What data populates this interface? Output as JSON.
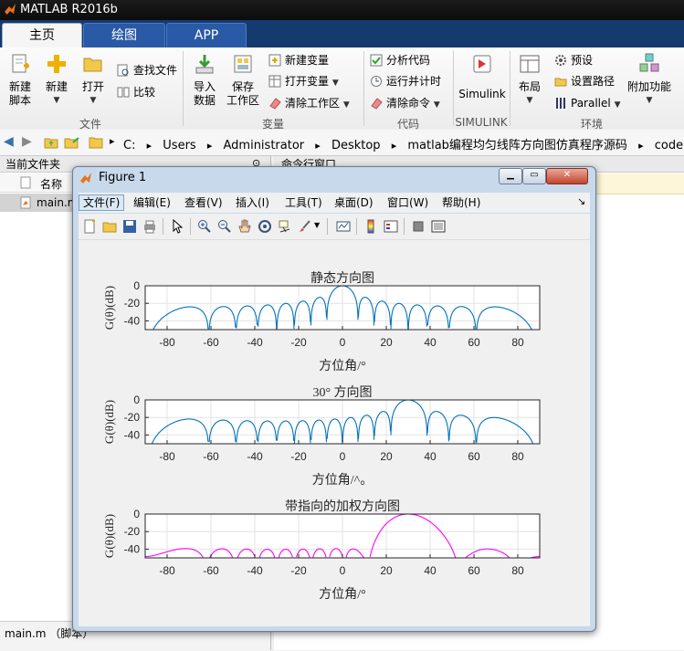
{
  "app": {
    "title": "MATLAB R2016b"
  },
  "tabs": [
    {
      "label": "主页",
      "active": true
    },
    {
      "label": "绘图",
      "active": false
    },
    {
      "label": "APP",
      "active": false
    }
  ],
  "ribbon": {
    "new_script_l1": "新建",
    "new_script_l2": "脚本",
    "new": "新建",
    "open": "打开",
    "find_files": "查找文件",
    "compare": "比较",
    "file_group": "文件",
    "import_l1": "导入",
    "import_l2": "数据",
    "save_ws_l1": "保存",
    "save_ws_l2": "工作区",
    "new_var": "新建变量",
    "open_var": "打开变量",
    "clear_ws": "清除工作区",
    "var_group": "变量",
    "analyze": "分析代码",
    "run_time": "运行并计时",
    "clear_cmd": "清除命令",
    "code_group": "代码",
    "simulink": "Simulink",
    "simulink_group": "SIMULINK",
    "layout": "布局",
    "prefs": "预设",
    "set_path": "设置路径",
    "parallel": "Parallel",
    "addons": "附加功能",
    "env_group": "环境"
  },
  "address": {
    "crumbs": [
      "C:",
      "Users",
      "Administrator",
      "Desktop",
      "matlab编程均匀线阵方向图仿真程序源码",
      "code"
    ]
  },
  "left_panel": {
    "title": "当前文件夹",
    "col_name": "名称",
    "file": "main.m",
    "status": "main.m （脚本）"
  },
  "right_panel": {
    "title": "命令行窗口"
  },
  "figure": {
    "title": "Figure 1",
    "menus": [
      "文件(F)",
      "编辑(E)",
      "查看(V)",
      "插入(I)",
      "工具(T)",
      "桌面(D)",
      "窗口(W)",
      "帮助(H)"
    ]
  },
  "chart_data": [
    {
      "type": "line",
      "title": "静态方向图",
      "xlabel": "方位角/°",
      "ylabel": "G(θ)(dB)",
      "xlim": [
        -90,
        90
      ],
      "ylim": [
        -50,
        0
      ],
      "xticks": [
        -80,
        -60,
        -40,
        -20,
        0,
        20,
        40,
        60,
        80
      ],
      "yticks": [
        0,
        -20,
        -40
      ],
      "grid": true,
      "color": "#0072bd",
      "array_elements": 16,
      "steer_deg": 0,
      "taper": "uniform"
    },
    {
      "type": "line",
      "title": "30° 方向图",
      "xlabel": "方位角/^。",
      "ylabel": "G(θ)(dB)",
      "xlim": [
        -90,
        90
      ],
      "ylim": [
        -50,
        0
      ],
      "xticks": [
        -80,
        -60,
        -40,
        -20,
        0,
        20,
        40,
        60,
        80
      ],
      "yticks": [
        0,
        -20,
        -40
      ],
      "grid": true,
      "color": "#0072bd",
      "array_elements": 16,
      "steer_deg": 30,
      "taper": "uniform"
    },
    {
      "type": "line",
      "title": "带指向的加权方向图",
      "xlabel": "方位角/°",
      "ylabel": "G(θ)(dB)",
      "xlim": [
        -90,
        90
      ],
      "ylim": [
        -50,
        0
      ],
      "xticks": [
        -80,
        -60,
        -40,
        -20,
        0,
        20,
        40,
        60,
        80
      ],
      "yticks": [
        0,
        -20,
        -40
      ],
      "grid": true,
      "color": "#ff00ff",
      "array_elements": 16,
      "steer_deg": 30,
      "taper": "hamming"
    }
  ]
}
